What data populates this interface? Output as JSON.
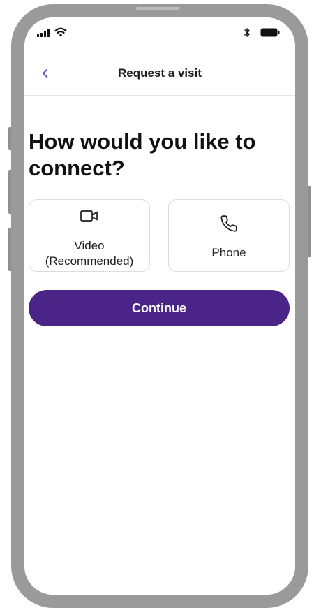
{
  "header": {
    "title": "Request a visit",
    "back_icon": "chevron-left-icon"
  },
  "main": {
    "heading": "How would you like to connect?",
    "options": [
      {
        "label": "Video\n(Recommended)",
        "icon": "video-camera-icon"
      },
      {
        "label": "Phone",
        "icon": "phone-icon"
      }
    ],
    "continue_label": "Continue"
  },
  "colors": {
    "accent": "#4a2486",
    "back_chevron": "#6f4bd1",
    "frame": "#9a9a9a"
  }
}
